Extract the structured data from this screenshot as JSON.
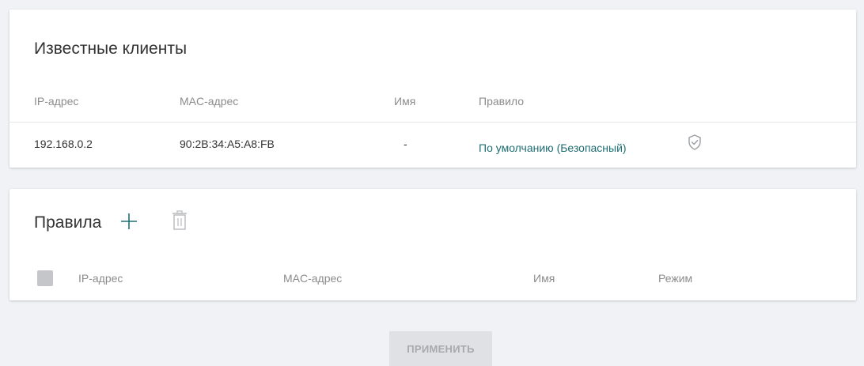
{
  "clients": {
    "title": "Известные клиенты",
    "columns": {
      "ip": "IP-адрес",
      "mac": "MAC-адрес",
      "name": "Имя",
      "rule": "Правило"
    },
    "rows": [
      {
        "ip": "192.168.0.2",
        "mac": "90:2B:34:A5:A8:FB",
        "name": "-",
        "rule": "По умолчанию (Безопасный)",
        "rule_icon": "shield-check-icon"
      }
    ]
  },
  "rules": {
    "title": "Правила",
    "add_icon": "plus-icon",
    "delete_icon": "trash-icon",
    "columns": {
      "ip": "IP-адрес",
      "mac": "MAC-адрес",
      "name": "Имя",
      "mode": "Режим"
    }
  },
  "footer": {
    "apply_label": "ПРИМЕНИТЬ"
  },
  "colors": {
    "accent_link": "#1f6e73",
    "background": "#f0f2f5",
    "muted_text": "#8c8c8c"
  }
}
